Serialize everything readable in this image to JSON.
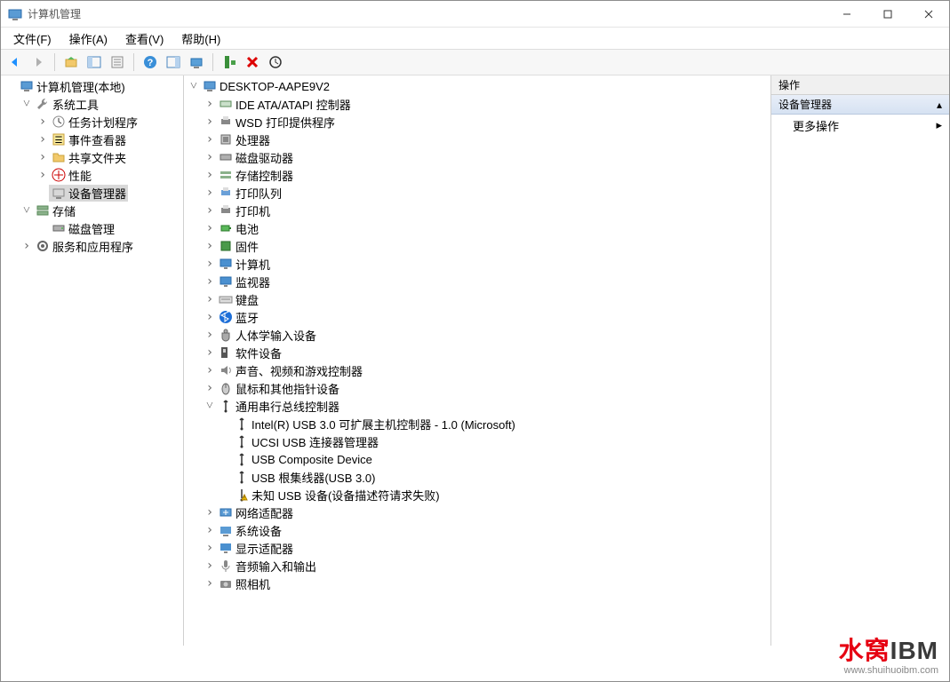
{
  "window": {
    "title": "计算机管理"
  },
  "menus": {
    "file": "文件(F)",
    "action": "操作(A)",
    "view": "查看(V)",
    "help": "帮助(H)"
  },
  "left_tree": [
    {
      "d": 0,
      "exp": "",
      "icon": "computer",
      "label": "计算机管理(本地)"
    },
    {
      "d": 1,
      "exp": "v",
      "icon": "wrench",
      "label": "系统工具"
    },
    {
      "d": 2,
      "exp": ">",
      "icon": "clock",
      "label": "任务计划程序"
    },
    {
      "d": 2,
      "exp": ">",
      "icon": "event",
      "label": "事件查看器"
    },
    {
      "d": 2,
      "exp": ">",
      "icon": "folder",
      "label": "共享文件夹"
    },
    {
      "d": 2,
      "exp": ">",
      "icon": "perf",
      "label": "性能"
    },
    {
      "d": 2,
      "exp": "",
      "icon": "device",
      "label": "设备管理器",
      "selected": true
    },
    {
      "d": 1,
      "exp": "v",
      "icon": "storage",
      "label": "存储"
    },
    {
      "d": 2,
      "exp": "",
      "icon": "disk",
      "label": "磁盘管理"
    },
    {
      "d": 1,
      "exp": ">",
      "icon": "services",
      "label": "服务和应用程序"
    }
  ],
  "mid_tree": [
    {
      "d": 0,
      "exp": "v",
      "icon": "pc",
      "label": "DESKTOP-AAPE9V2"
    },
    {
      "d": 1,
      "exp": ">",
      "icon": "ide",
      "label": "IDE ATA/ATAPI 控制器"
    },
    {
      "d": 1,
      "exp": ">",
      "icon": "printer",
      "label": "WSD 打印提供程序"
    },
    {
      "d": 1,
      "exp": ">",
      "icon": "cpu",
      "label": "处理器"
    },
    {
      "d": 1,
      "exp": ">",
      "icon": "drive",
      "label": "磁盘驱动器"
    },
    {
      "d": 1,
      "exp": ">",
      "icon": "storectl",
      "label": "存储控制器"
    },
    {
      "d": 1,
      "exp": ">",
      "icon": "queue",
      "label": "打印队列"
    },
    {
      "d": 1,
      "exp": ">",
      "icon": "printer",
      "label": "打印机"
    },
    {
      "d": 1,
      "exp": ">",
      "icon": "battery",
      "label": "电池"
    },
    {
      "d": 1,
      "exp": ">",
      "icon": "firmware",
      "label": "固件"
    },
    {
      "d": 1,
      "exp": ">",
      "icon": "monitor",
      "label": "计算机"
    },
    {
      "d": 1,
      "exp": ">",
      "icon": "monitor",
      "label": "监视器"
    },
    {
      "d": 1,
      "exp": ">",
      "icon": "keyboard",
      "label": "键盘"
    },
    {
      "d": 1,
      "exp": ">",
      "icon": "bt",
      "label": "蓝牙"
    },
    {
      "d": 1,
      "exp": ">",
      "icon": "hid",
      "label": "人体学输入设备"
    },
    {
      "d": 1,
      "exp": ">",
      "icon": "sw",
      "label": "软件设备"
    },
    {
      "d": 1,
      "exp": ">",
      "icon": "audio",
      "label": "声音、视频和游戏控制器"
    },
    {
      "d": 1,
      "exp": ">",
      "icon": "mouse",
      "label": "鼠标和其他指针设备"
    },
    {
      "d": 1,
      "exp": "v",
      "icon": "usb",
      "label": "通用串行总线控制器"
    },
    {
      "d": 2,
      "exp": "",
      "icon": "usb",
      "label": "Intel(R) USB 3.0 可扩展主机控制器 - 1.0 (Microsoft)"
    },
    {
      "d": 2,
      "exp": "",
      "icon": "usb",
      "label": "UCSI USB 连接器管理器"
    },
    {
      "d": 2,
      "exp": "",
      "icon": "usb",
      "label": "USB Composite Device"
    },
    {
      "d": 2,
      "exp": "",
      "icon": "usb",
      "label": "USB 根集线器(USB 3.0)"
    },
    {
      "d": 2,
      "exp": "",
      "icon": "usbwarn",
      "label": "未知 USB 设备(设备描述符请求失败)"
    },
    {
      "d": 1,
      "exp": ">",
      "icon": "net",
      "label": "网络适配器"
    },
    {
      "d": 1,
      "exp": ">",
      "icon": "sys",
      "label": "系统设备"
    },
    {
      "d": 1,
      "exp": ">",
      "icon": "display",
      "label": "显示适配器"
    },
    {
      "d": 1,
      "exp": ">",
      "icon": "mic",
      "label": "音频输入和输出"
    },
    {
      "d": 1,
      "exp": ">",
      "icon": "camera",
      "label": "照相机"
    }
  ],
  "right": {
    "header": "操作",
    "section": "设备管理器",
    "more": "更多操作"
  },
  "watermark": {
    "text1": "水窝",
    "text2": "IBM",
    "url": "www.shuihuoibm.com"
  }
}
